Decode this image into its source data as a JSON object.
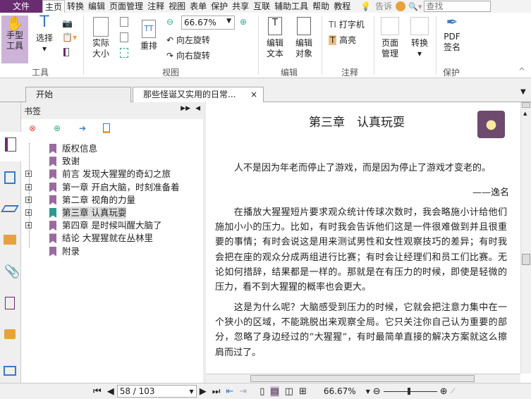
{
  "menu": {
    "file": "文件",
    "items": [
      "主页",
      "转换",
      "编辑",
      "页面管理",
      "注释",
      "视图",
      "表单",
      "保护",
      "共享",
      "互联",
      "辅助工具",
      "帮助",
      "教程"
    ],
    "tell": "告诉",
    "search_placeholder": "查找"
  },
  "ribbon": {
    "hand": "手型工具",
    "select": "选择",
    "actual_size": "实际大小",
    "reflow": "重排",
    "zoom_value": "66.67%",
    "rotate_left": "向左旋转",
    "rotate_right": "向右旋转",
    "edit_text": "编辑文本",
    "edit_object": "编辑对象",
    "typewriter": "打字机",
    "highlight": "高亮",
    "page_manage": "页面管理",
    "convert": "转换",
    "pdf_sign": "PDF签名",
    "groups": {
      "tools": "工具",
      "view": "视图",
      "edit": "编辑",
      "comment": "注释",
      "protect": "保护"
    }
  },
  "tabs": [
    {
      "label": "开始"
    },
    {
      "label": "那些怪诞又实用的日常..."
    }
  ],
  "bookmarks": {
    "title": "书签",
    "items": [
      {
        "label": "版权信息",
        "expandable": false
      },
      {
        "label": "致谢",
        "expandable": false
      },
      {
        "label": "前言 发现大猩猩的奇幻之旅",
        "expandable": true
      },
      {
        "label": "第一章 开启大脑，时刻准备着",
        "expandable": true
      },
      {
        "label": "第二章 视角的力量",
        "expandable": true
      },
      {
        "label": "第三章 认真玩耍",
        "expandable": true,
        "selected": true
      },
      {
        "label": "第四章 是时候叫醒大脑了",
        "expandable": true
      },
      {
        "label": "结论 大猩猩就在丛林里",
        "expandable": false
      },
      {
        "label": "附录",
        "expandable": false
      }
    ]
  },
  "document": {
    "title": "第三章　认真玩耍",
    "quote": "人不是因为年老而停止了游戏，而是因为停止了游戏才变老的。",
    "attribution": "——逸名",
    "para1": [
      "　　在播放大猩猩短片要求观众统计传球次数时，我会略施小计给他们",
      "施加小小的压力。比如，有时我会告诉他们这是一件很难做到并且很重",
      "要的事情；有时会说这是用来测试男性和女性观察技巧的差异；有时我",
      "会把在座的观众分成两组进行比赛；有时会让经理们和员工们比赛。无",
      "论如何措辞，结果都是一样的。那就是在有压力的时候，即使是轻微的",
      "压力，看不到大猩猩的概率也会更大。"
    ],
    "para2": [
      "　　这是为什么呢？大脑感受到压力的时候，它就会把注意力集中在一",
      "个狭小的区域，不能跳脱出来观察全局。它只关注你自己认为重要的部",
      "分，忽略了身边经过的“大猩猩”，有时最简单直接的解决方案就这么擦",
      "肩而过了。"
    ]
  },
  "status": {
    "page": "58 / 103",
    "zoom": "66.67%",
    "zoom_fraction": 0.45
  },
  "colors": {
    "brand": "#6a2c71",
    "bookmark": "#9a6aa0",
    "bookmark_selected": "#2e9a92"
  }
}
